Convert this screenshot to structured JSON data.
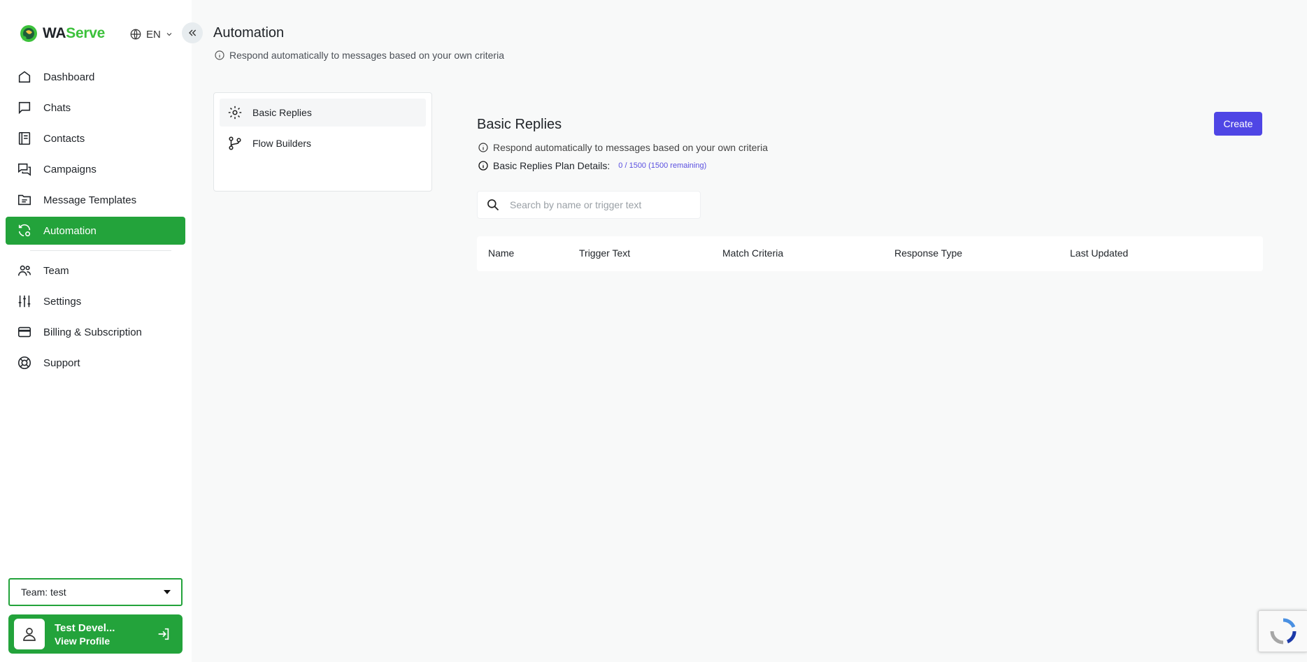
{
  "brand": {
    "wa": "WA",
    "serve": "Serve"
  },
  "language": {
    "code": "EN"
  },
  "sidebar": {
    "items": [
      {
        "label": "Dashboard",
        "icon": "home-icon"
      },
      {
        "label": "Chats",
        "icon": "chat-icon"
      },
      {
        "label": "Contacts",
        "icon": "contacts-book-icon"
      },
      {
        "label": "Campaigns",
        "icon": "campaigns-icon"
      },
      {
        "label": "Message Templates",
        "icon": "folder-icon"
      },
      {
        "label": "Automation",
        "icon": "automation-icon",
        "active": true
      },
      {
        "label": "Team",
        "icon": "team-icon"
      },
      {
        "label": "Settings",
        "icon": "sliders-icon"
      },
      {
        "label": "Billing & Subscription",
        "icon": "credit-card-icon"
      },
      {
        "label": "Support",
        "icon": "lifebuoy-icon"
      }
    ],
    "team_select": "Team: test",
    "profile": {
      "name": "Test Devel...",
      "link": "View Profile"
    }
  },
  "header": {
    "title": "Automation",
    "subtitle": "Respond automatically to messages based on your own criteria"
  },
  "subnav": {
    "items": [
      {
        "label": "Basic Replies",
        "icon": "gear-icon",
        "active": true
      },
      {
        "label": "Flow Builders",
        "icon": "flow-branch-icon"
      }
    ]
  },
  "content": {
    "title": "Basic Replies",
    "description": "Respond automatically to messages based on your own criteria",
    "plan_label": "Basic Replies Plan Details:",
    "plan_value": "0 / 1500 (1500 remaining)",
    "create_label": "Create",
    "search_placeholder": "Search by name or trigger text"
  },
  "table": {
    "columns": [
      "Name",
      "Trigger Text",
      "Match Criteria",
      "Response Type",
      "Last Updated"
    ],
    "rows": []
  },
  "colors": {
    "accent": "#23a33b",
    "primary_button": "#4f46e5",
    "plan_value": "#5a4fe0"
  }
}
